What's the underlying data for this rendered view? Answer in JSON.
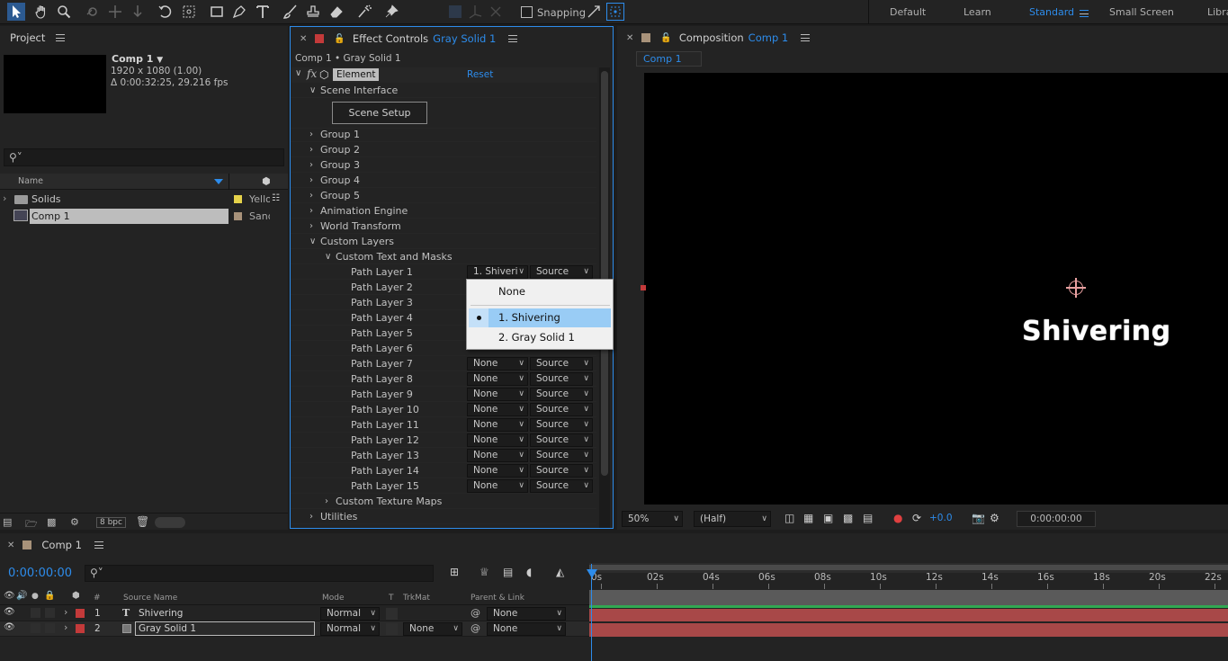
{
  "toolbar": {
    "snapping_label": "Snapping",
    "workspaces": [
      "Default",
      "Learn",
      "Standard",
      "Small Screen",
      "Libra"
    ],
    "active_workspace": "Standard"
  },
  "project": {
    "title": "Project",
    "selected_name": "Comp 1",
    "selected_info1": "1920 x 1080 (1.00)",
    "selected_info2": "Δ 0:00:32:25, 29.216 fps",
    "search_placeholder": "",
    "col_name": "Name",
    "items": [
      {
        "name": "Solids",
        "label": "Yello",
        "swatch": "#e5d24a",
        "type": "folder"
      },
      {
        "name": "Comp 1",
        "label": "Sand",
        "swatch": "#a8927a",
        "type": "comp"
      }
    ],
    "bpc": "8 bpc"
  },
  "effect_controls": {
    "title": "Effect Controls",
    "layer": "Gray Solid 1",
    "breadcrumb": "Comp 1 • Gray Solid 1",
    "effect_name": "Element",
    "reset": "Reset",
    "scene_interface": "Scene Interface",
    "scene_setup": "Scene Setup",
    "groups": [
      "Group 1",
      "Group 2",
      "Group 3",
      "Group 4",
      "Group 5",
      "Animation Engine",
      "World Transform"
    ],
    "custom_layers": "Custom Layers",
    "custom_text_masks": "Custom Text and Masks",
    "path_layers": [
      {
        "label": "Path Layer 1",
        "value": "1. Shiveri",
        "mode": "Source"
      },
      {
        "label": "Path Layer 2",
        "value": "",
        "mode": ""
      },
      {
        "label": "Path Layer 3",
        "value": "",
        "mode": ""
      },
      {
        "label": "Path Layer 4",
        "value": "",
        "mode": ""
      },
      {
        "label": "Path Layer 5",
        "value": "",
        "mode": ""
      },
      {
        "label": "Path Layer 6",
        "value": "",
        "mode": ""
      },
      {
        "label": "Path Layer 7",
        "value": "None",
        "mode": "Source"
      },
      {
        "label": "Path Layer 8",
        "value": "None",
        "mode": "Source"
      },
      {
        "label": "Path Layer 9",
        "value": "None",
        "mode": "Source"
      },
      {
        "label": "Path Layer 10",
        "value": "None",
        "mode": "Source"
      },
      {
        "label": "Path Layer 11",
        "value": "None",
        "mode": "Source"
      },
      {
        "label": "Path Layer 12",
        "value": "None",
        "mode": "Source"
      },
      {
        "label": "Path Layer 13",
        "value": "None",
        "mode": "Source"
      },
      {
        "label": "Path Layer 14",
        "value": "None",
        "mode": "Source"
      },
      {
        "label": "Path Layer 15",
        "value": "None",
        "mode": "Source"
      }
    ],
    "custom_texture_maps": "Custom Texture Maps",
    "utilities": "Utilities",
    "popup": {
      "options": [
        "None",
        "1. Shivering",
        "2. Gray Solid 1"
      ],
      "selected": "1. Shivering"
    }
  },
  "composition": {
    "title": "Composition",
    "comp_name": "Comp 1",
    "tab": "Comp 1",
    "canvas_text": "Shivering",
    "zoom": "50%",
    "resolution": "(Half)",
    "exposure": "+0.0",
    "timecode": "0:00:00:00"
  },
  "timeline": {
    "tab": "Comp 1",
    "timecode": "0:00:00:00",
    "columns": {
      "num": "#",
      "source": "Source Name",
      "mode": "Mode",
      "t": "T",
      "trkmat": "TrkMat",
      "parent": "Parent & Link"
    },
    "ruler": [
      "0s",
      "02s",
      "04s",
      "06s",
      "08s",
      "10s",
      "12s",
      "14s",
      "16s",
      "18s",
      "20s",
      "22s"
    ],
    "layers": [
      {
        "num": "1",
        "type": "T",
        "name": "Shivering",
        "mode": "Normal",
        "trkmat": "",
        "parent": "None",
        "color": "#c33a3a"
      },
      {
        "num": "2",
        "type": "",
        "name": "Gray Solid 1",
        "mode": "Normal",
        "trkmat": "None",
        "parent": "None",
        "color": "#c33a3a"
      }
    ]
  },
  "colors": {
    "accent": "#2d8ceb",
    "track_bar": "#a84848",
    "label_red": "#c33a3a"
  }
}
